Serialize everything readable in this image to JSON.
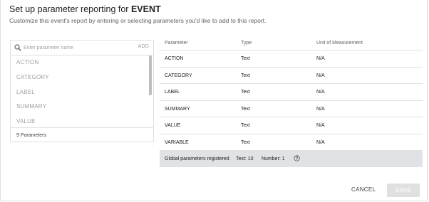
{
  "dialog": {
    "title_prefix": "Set up parameter reporting for ",
    "title_event": "EVENT",
    "subtitle": "Customize this event's report by entering or selecting parameters you'd like to add to this report."
  },
  "left_panel": {
    "search_placeholder": "Enter parameter name",
    "search_icon": "search-icon",
    "add_label": "ADD",
    "items": [
      "ACTION",
      "CATEGORY",
      "LABEL",
      "SUMMARY",
      "VALUE"
    ],
    "count_label": "9 Parameters"
  },
  "table": {
    "headers": [
      "Parameter",
      "Type",
      "Unit of Measurement"
    ],
    "rows": [
      [
        "ACTION",
        "Text",
        "N/A"
      ],
      [
        "CATEGORY",
        "Text",
        "N/A"
      ],
      [
        "LABEL",
        "Text",
        "N/A"
      ],
      [
        "SUMMARY",
        "Text",
        "N/A"
      ],
      [
        "VALUE",
        "Text",
        "N/A"
      ],
      [
        "VARIABLE",
        "Text",
        "N/A"
      ]
    ],
    "footer": {
      "label": "Global parameters registered",
      "text_count": "Text: 10",
      "number_count": "Number: 1",
      "help_icon": "help-circle-icon"
    }
  },
  "actions": {
    "cancel": "CANCEL",
    "save": "SAVE"
  },
  "colors": {
    "footer_bg": "#dfe3e5",
    "disabled_button": "#e0e0e0"
  }
}
